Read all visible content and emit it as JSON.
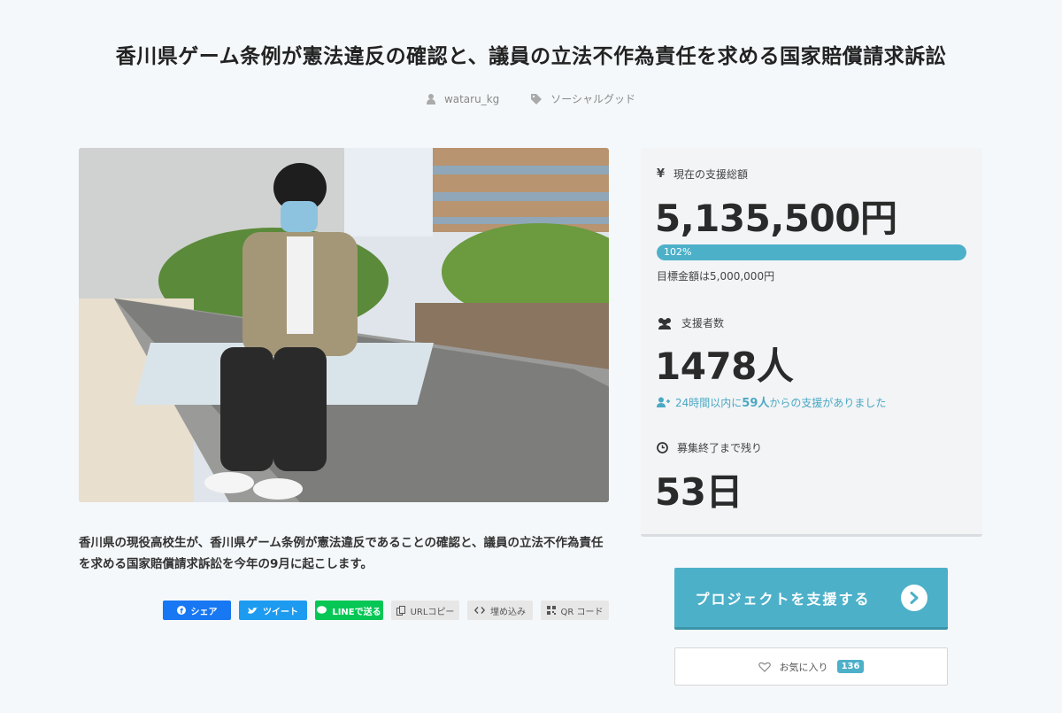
{
  "project": {
    "title": "香川県ゲーム条例が憲法違反の確認と、議員の立法不作為責任を求める国家賠償請求訴訟",
    "author": "wataru_kg",
    "category": "ソーシャルグッド",
    "description": "香川県の現役高校生が、香川県ゲーム条例が憲法違反であることの確認と、議員の立法不作為責任を求める国家賠償請求訴訟を今年の9月に起こします。"
  },
  "share": {
    "facebook": "シェア",
    "twitter": "ツイート",
    "line": "LINEで送る",
    "url_copy": "URLコピー",
    "embed": "埋め込み",
    "qr": "QR コード"
  },
  "stats": {
    "total_label": "現在の支援総額",
    "total_amount": "5,135,500円",
    "progress_text": "102%",
    "progress_value": 1.02,
    "goal_text": "目標金額は5,000,000円",
    "backers_label": "支援者数",
    "backers_count": "1478人",
    "recent_prefix": "24時間以内に",
    "recent_number": "59人",
    "recent_suffix": "からの支援がありました",
    "remaining_label": "募集終了まで残り",
    "remaining_days": "53日"
  },
  "actions": {
    "support_button": "プロジェクトを支援する",
    "favorite_label": "お気に入り",
    "favorite_count": "136"
  },
  "colors": {
    "accent": "#4db0c9",
    "facebook": "#1877f2",
    "twitter": "#1d9bf0",
    "line": "#06c755"
  }
}
